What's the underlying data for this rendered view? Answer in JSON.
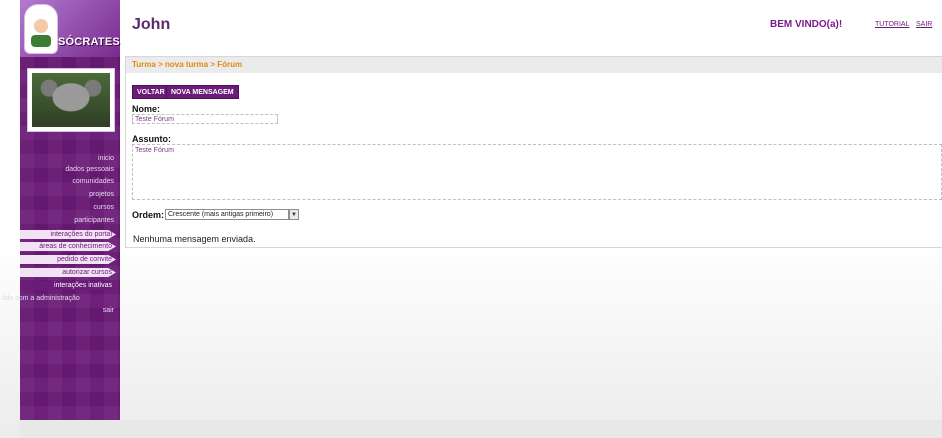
{
  "app": {
    "brand": "SÓCRATES",
    "logo_icon": "socrates-mascot-icon"
  },
  "header": {
    "user_name": "John",
    "welcome": "BEM VINDO(a)!",
    "tutorial_link": "TUTORIAL",
    "logout_link": "SAIR"
  },
  "sidebar": {
    "links": [
      "inicio",
      "dados pessoais",
      "comunidades",
      "projetos",
      "cursos",
      "participantes"
    ],
    "tabs": [
      {
        "label": "interações do portal",
        "dark": false
      },
      {
        "label": "áreas de conhecimento",
        "dark": false
      },
      {
        "label": "pedido de convite",
        "dark": false
      },
      {
        "label": "autorizar cursos",
        "dark": false
      },
      {
        "label": "interações inativas",
        "dark": true
      }
    ],
    "footer_links": [
      "fale com a administração",
      "sair"
    ]
  },
  "breadcrumb": "Turma > nova turma > Fórum",
  "buttons": {
    "back": "VOLTAR",
    "new_message": "NOVA MENSAGEM"
  },
  "form": {
    "nome_label": "Nome:",
    "nome_value": "Teste Fórum",
    "assunto_label": "Assunto:",
    "assunto_value": "Teste Fórum",
    "ordem_label": "Ordem:",
    "ordem_value": "Crescente (mais antigas primeiro)"
  },
  "status_text": "Nenhuma mensagem enviada.",
  "colors": {
    "sidebar": "#6b1b78",
    "accent": "#e08a12",
    "button": "#6b1b78"
  }
}
